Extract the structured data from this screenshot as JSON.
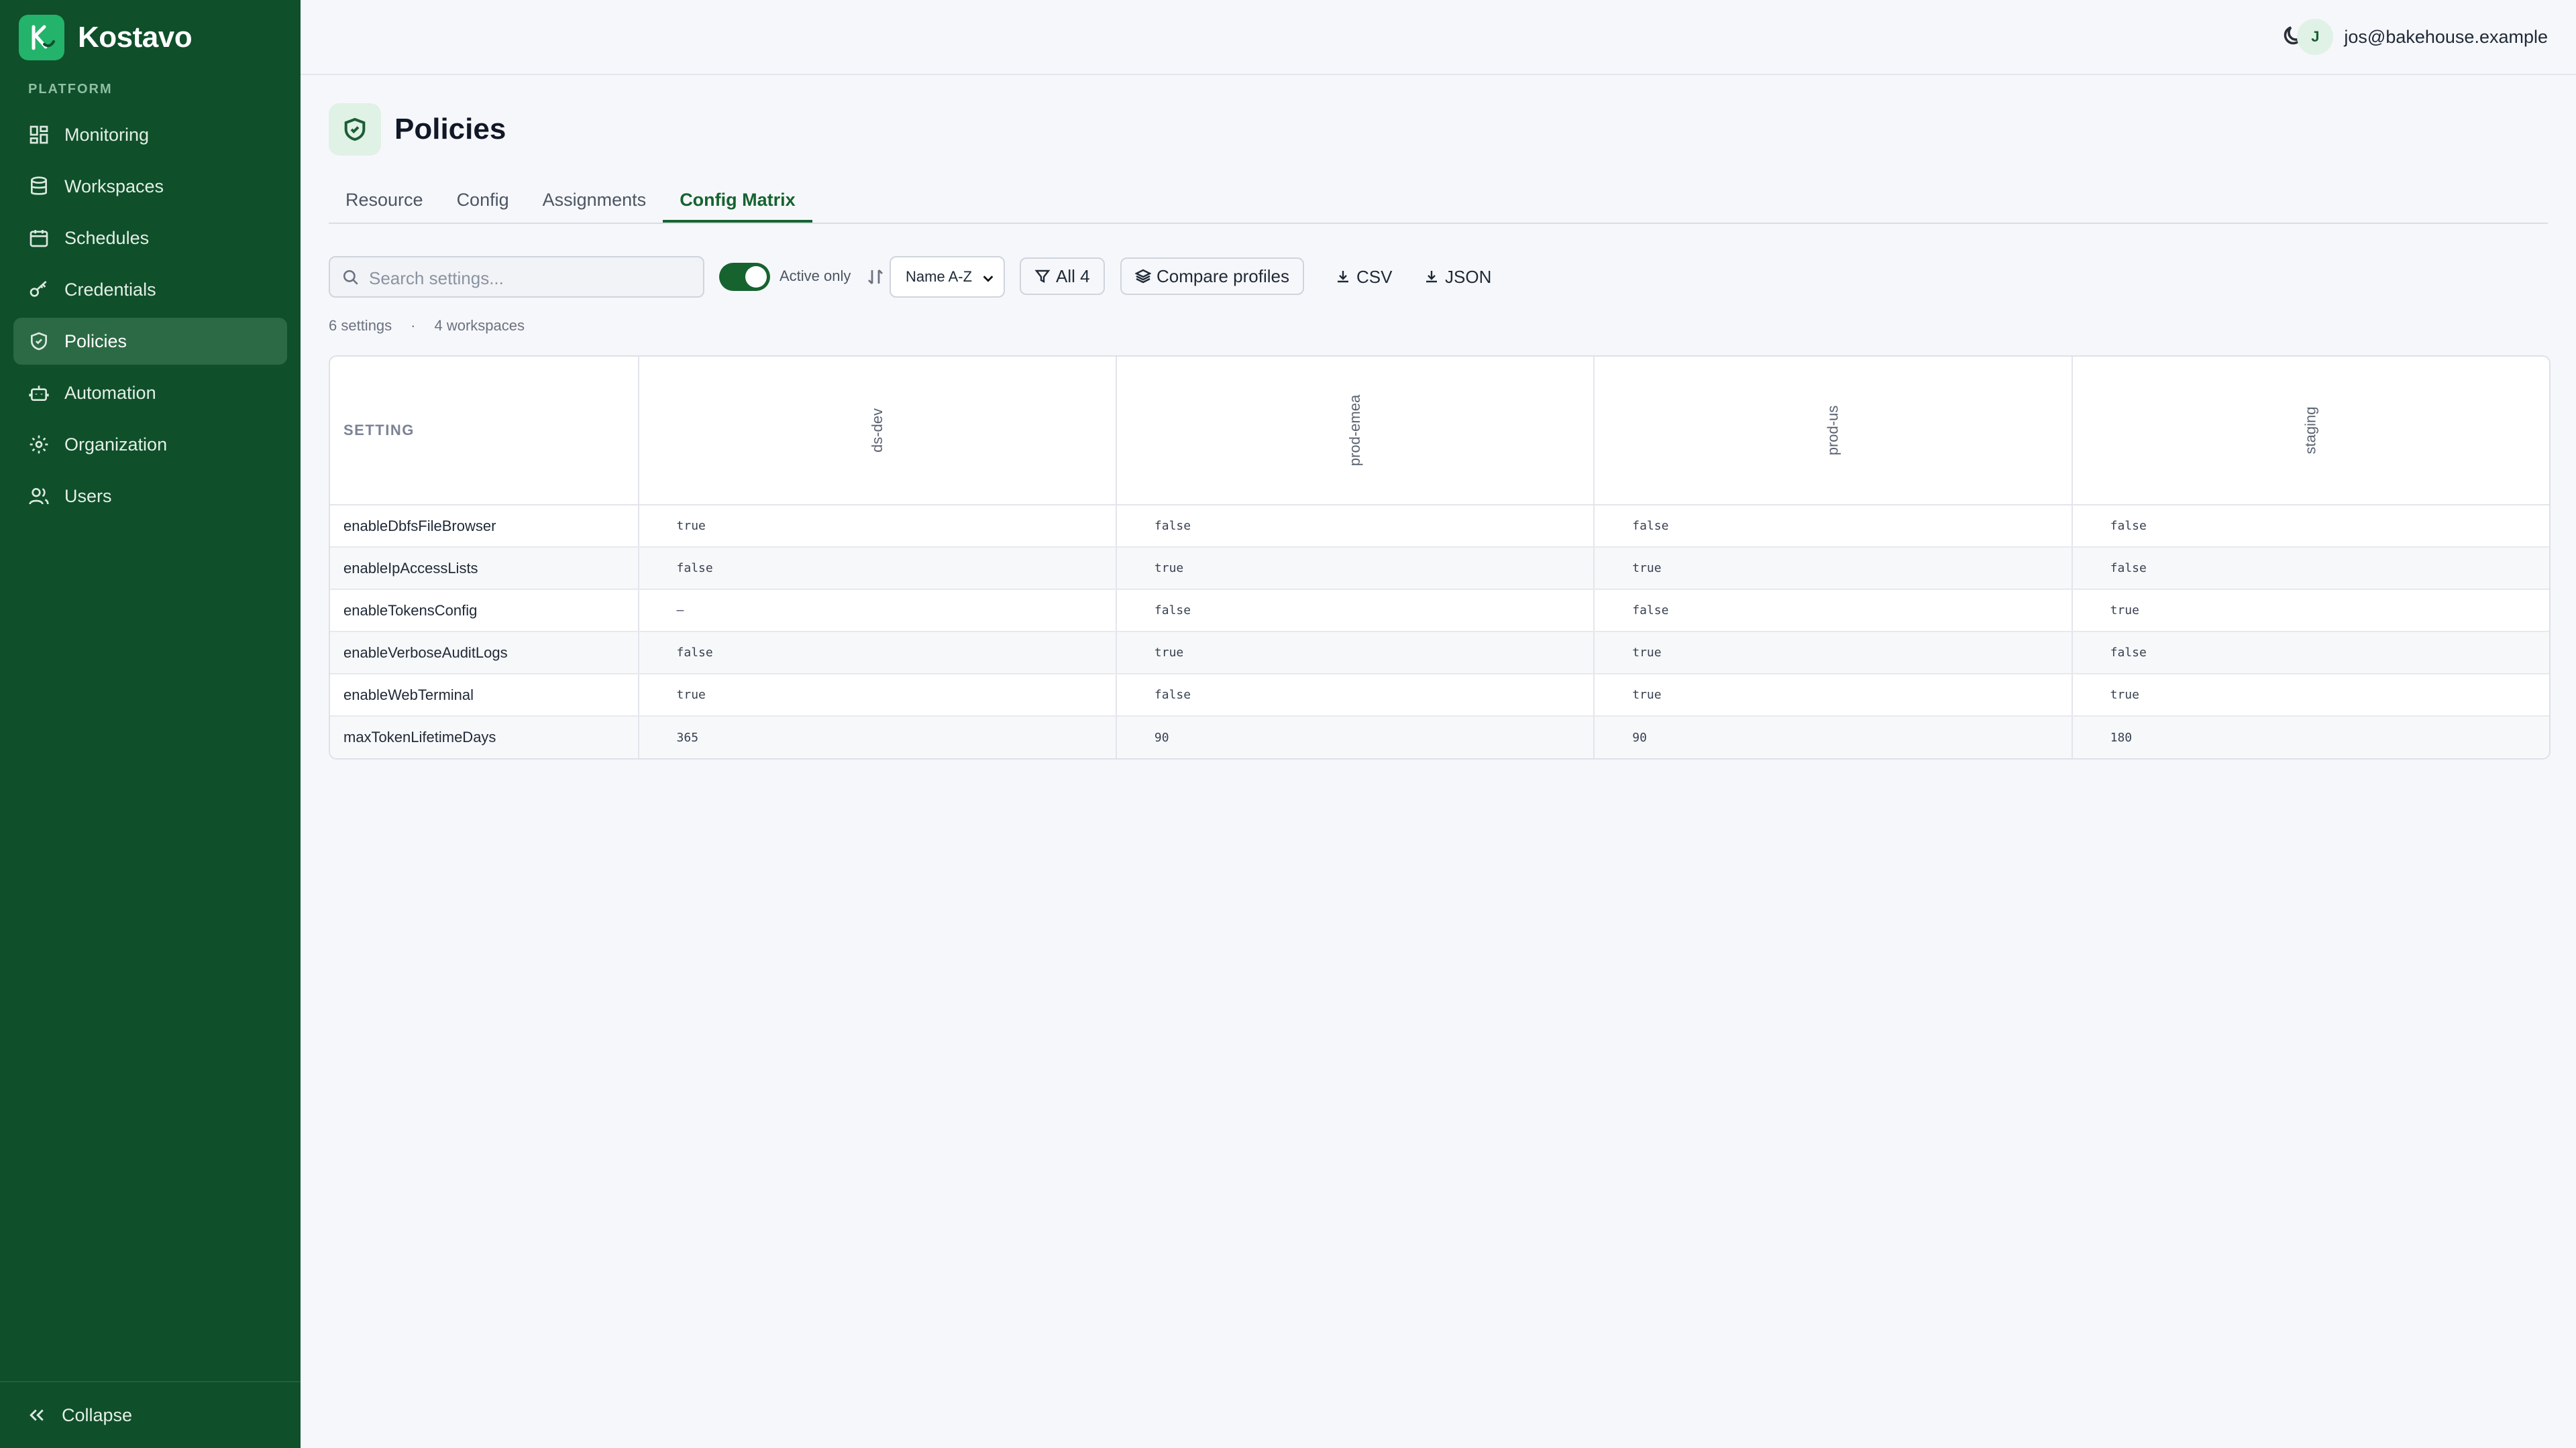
{
  "brand": {
    "mark": "K",
    "name": "Kostavo"
  },
  "sidebar": {
    "section_label": "PLATFORM",
    "items": [
      {
        "label": "Monitoring",
        "icon": "dashboard-icon"
      },
      {
        "label": "Workspaces",
        "icon": "database-icon"
      },
      {
        "label": "Schedules",
        "icon": "calendar-icon"
      },
      {
        "label": "Credentials",
        "icon": "key-icon"
      },
      {
        "label": "Policies",
        "icon": "shield-icon",
        "active": true
      },
      {
        "label": "Automation",
        "icon": "robot-icon"
      },
      {
        "label": "Organization",
        "icon": "gear-icon"
      },
      {
        "label": "Users",
        "icon": "users-icon"
      }
    ],
    "collapse_label": "Collapse"
  },
  "header": {
    "user_initial": "J",
    "user_email": "jos@bakehouse.example"
  },
  "page": {
    "title": "Policies",
    "tabs": [
      {
        "label": "Resource"
      },
      {
        "label": "Config"
      },
      {
        "label": "Assignments"
      },
      {
        "label": "Config Matrix",
        "active": true
      }
    ]
  },
  "toolbar": {
    "search_placeholder": "Search settings...",
    "toggle_label": "Active only",
    "sort_value": "Name A-Z",
    "filter_label": "All 4",
    "compare_label": "Compare profiles",
    "csv_label": "CSV",
    "json_label": "JSON"
  },
  "meta": {
    "settings_count": "6 settings",
    "separator": "·",
    "workspaces_count": "4 workspaces"
  },
  "matrix": {
    "setting_header": "SETTING",
    "workspaces": [
      "ds-dev",
      "prod-emea",
      "prod-us",
      "staging"
    ],
    "rows": [
      {
        "setting": "enableDbfsFileBrowser",
        "values": [
          "true",
          "false",
          "false",
          "false"
        ]
      },
      {
        "setting": "enableIpAccessLists",
        "values": [
          "false",
          "true",
          "true",
          "false"
        ]
      },
      {
        "setting": "enableTokensConfig",
        "values": [
          "–",
          "false",
          "false",
          "true"
        ]
      },
      {
        "setting": "enableVerboseAuditLogs",
        "values": [
          "false",
          "true",
          "true",
          "false"
        ]
      },
      {
        "setting": "enableWebTerminal",
        "values": [
          "true",
          "false",
          "true",
          "true"
        ]
      },
      {
        "setting": "maxTokenLifetimeDays",
        "values": [
          "365",
          "90",
          "90",
          "180"
        ]
      }
    ]
  },
  "colors": {
    "sidebar_bg": "#0f4f2a",
    "accent": "#16632f",
    "brand_mark": "#23b36b"
  }
}
